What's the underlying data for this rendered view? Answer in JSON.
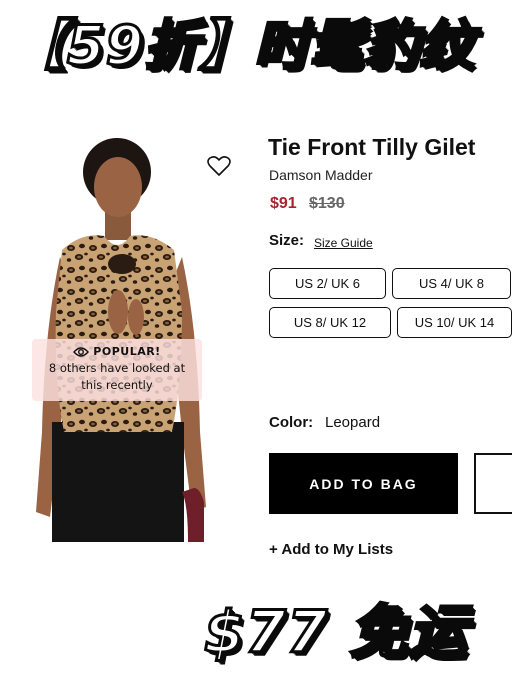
{
  "promo": {
    "top_text": "【59折】时髦豹纹",
    "bottom_text": "$77 免运"
  },
  "badge": {
    "title": "POPULAR!",
    "text": "8 others have looked at this recently"
  },
  "product": {
    "title": "Tie Front Tilly Gilet",
    "brand": "Damson Madder",
    "sale_price": "$91",
    "original_price": "$130"
  },
  "size": {
    "label": "Size:",
    "guide_label": "Size Guide",
    "options": [
      "US 2/ UK 6",
      "US 4/ UK 8",
      "US 8/ UK 12",
      "US 10/ UK 14"
    ]
  },
  "color": {
    "label": "Color:",
    "value": "Leopard"
  },
  "actions": {
    "add_to_bag": "ADD TO BAG",
    "add_to_lists": "+ Add to My Lists"
  },
  "colors": {
    "sale": "#a4262c",
    "badge_bg": "#fce0e0",
    "button_bg": "#000000"
  },
  "icons": [
    "heart-icon",
    "eye-icon"
  ]
}
